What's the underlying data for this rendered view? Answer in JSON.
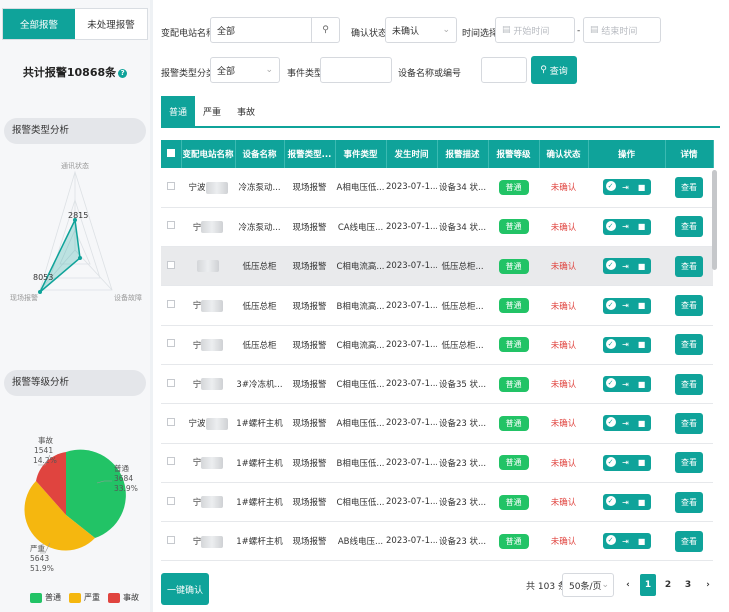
{
  "left": {
    "tabs": [
      "全部报警",
      "未处理报警"
    ],
    "total": "共计报警10868条",
    "sections": {
      "type": "报警类型分析",
      "level": "报警等级分析"
    },
    "radar": {
      "labels": [
        "通讯状态",
        "现场报警",
        "设备故障"
      ],
      "values": [
        "2815",
        "8053"
      ]
    },
    "pie": {
      "labels": [
        {
          "name": "事故",
          "value": "1541",
          "pct": "14.2%"
        },
        {
          "name": "普通",
          "value": "3684",
          "pct": "33.9%"
        },
        {
          "name": "严重",
          "value": "5643",
          "pct": "51.9%"
        }
      ],
      "colors": {
        "普通": "#22c366",
        "严重": "#f5b70f",
        "事故": "#e0443f"
      }
    },
    "legend": [
      "普通",
      "严重",
      "事故"
    ]
  },
  "filters": {
    "station_label": "变配电站名称",
    "station_value": "全部",
    "confirm_label": "确认状态",
    "confirm_value": "未确认",
    "time_label": "时间选择",
    "start_ph": "开始时间",
    "end_ph": "结束时间",
    "dash": "-",
    "type_label": "报警类型分类",
    "type_value": "全部",
    "event_label": "事件类型",
    "device_label": "设备名称或编号",
    "query": "查询"
  },
  "subtabs": [
    "普通",
    "严重",
    "事故"
  ],
  "table": {
    "headers": [
      "变配电站名称",
      "设备名称",
      "报警类型...",
      "事件类型",
      "发生时间",
      "报警描述",
      "报警等级",
      "确认状态",
      "操作",
      "详情"
    ],
    "rows": [
      [
        "宁波",
        "冷冻泵动...",
        "现场报警",
        "A相电压低...",
        "2023-07-1...",
        "设备34 状...",
        "普通",
        "未确认",
        "查看"
      ],
      [
        "宁",
        "冷冻泵动...",
        "现场报警",
        "CA线电压...",
        "2023-07-1...",
        "设备34 状...",
        "普通",
        "未确认",
        "查看"
      ],
      [
        "",
        "低压总柜",
        "现场报警",
        "C相电流高...",
        "2023-07-1...",
        "低压总柜...",
        "普通",
        "未确认",
        "查看"
      ],
      [
        "宁",
        "低压总柜",
        "现场报警",
        "B相电流高...",
        "2023-07-1...",
        "低压总柜...",
        "普通",
        "未确认",
        "查看"
      ],
      [
        "宁",
        "低压总柜",
        "现场报警",
        "C相电流高...",
        "2023-07-1...",
        "低压总柜...",
        "普通",
        "未确认",
        "查看"
      ],
      [
        "宁",
        "3#冷冻机...",
        "现场报警",
        "C相电压低...",
        "2023-07-1...",
        "设备35 状...",
        "普通",
        "未确认",
        "查看"
      ],
      [
        "宁波",
        "1#螺杆主机",
        "现场报警",
        "A相电压低...",
        "2023-07-1...",
        "设备23 状...",
        "普通",
        "未确认",
        "查看"
      ],
      [
        "宁",
        "1#螺杆主机",
        "现场报警",
        "B相电压低...",
        "2023-07-1...",
        "设备23 状...",
        "普通",
        "未确认",
        "查看"
      ],
      [
        "宁",
        "1#螺杆主机",
        "现场报警",
        "C相电压低...",
        "2023-07-1...",
        "设备23 状...",
        "普通",
        "未确认",
        "查看"
      ],
      [
        "宁",
        "1#螺杆主机",
        "现场报警",
        "AB线电压...",
        "2023-07-1...",
        "设备23 状...",
        "普通",
        "未确认",
        "查看"
      ]
    ]
  },
  "footer": {
    "confirm_all": "一键确认",
    "total": "共 103 条",
    "page_size": "50条/页",
    "pages": [
      "1",
      "2",
      "3"
    ],
    "prev": "‹",
    "next": "›"
  }
}
